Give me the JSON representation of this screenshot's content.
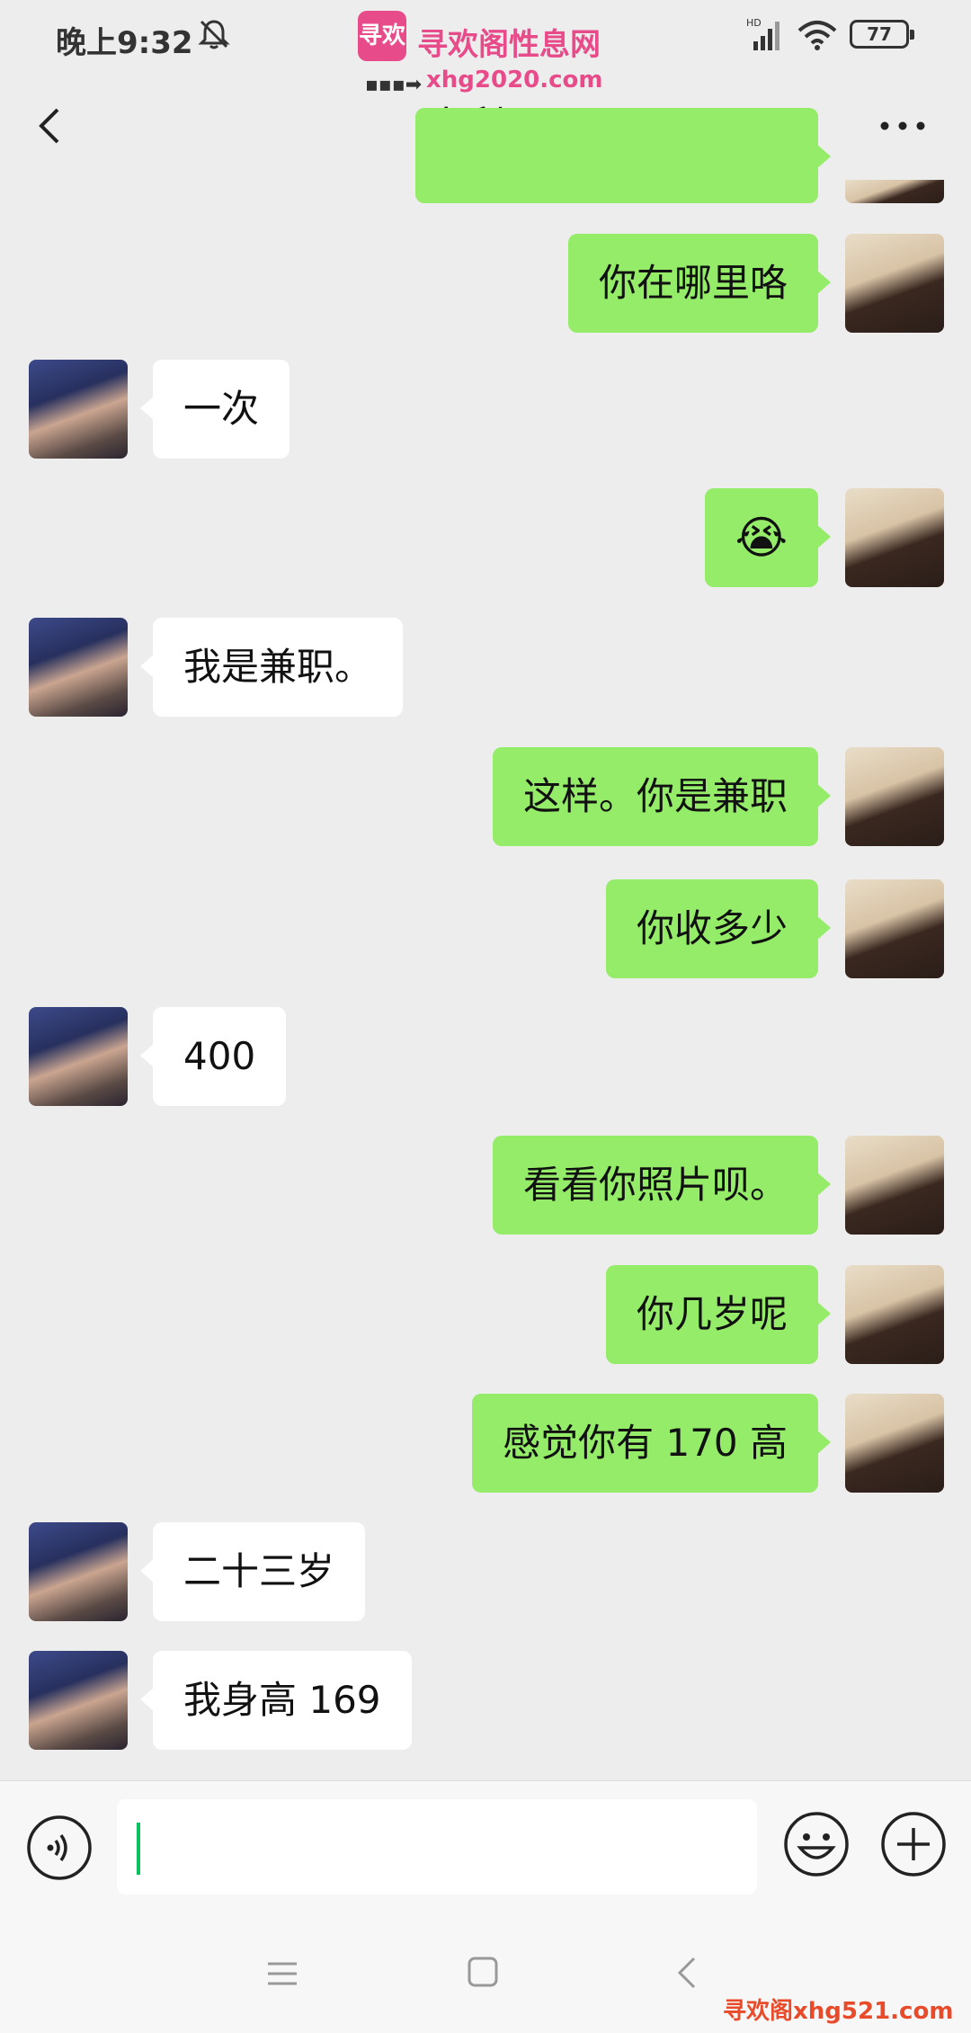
{
  "status_bar": {
    "time": "晚上9:32",
    "battery": "77",
    "signal_label": "HD"
  },
  "watermark": {
    "logo": "寻欢",
    "title": "寻欢阁性息网",
    "url": "xhg2020.com",
    "bottom": "寻欢阁xhg521.com"
  },
  "header": {
    "title": "小利子"
  },
  "messages": [
    {
      "from": "me",
      "text": "你在哪里咯"
    },
    {
      "from": "her",
      "text": "一次"
    },
    {
      "from": "me",
      "text": "😭"
    },
    {
      "from": "her",
      "text": "我是兼职。"
    },
    {
      "from": "me",
      "text": "这样。你是兼职"
    },
    {
      "from": "me",
      "text": "你收多少"
    },
    {
      "from": "her",
      "text": "400"
    },
    {
      "from": "me",
      "text": "看看你照片呗。"
    },
    {
      "from": "me",
      "text": "你几岁呢"
    },
    {
      "from": "me",
      "text": "感觉你有 170 高"
    },
    {
      "from": "her",
      "text": "二十三岁"
    },
    {
      "from": "her",
      "text": "我身高 169"
    }
  ],
  "input": {
    "value": ""
  },
  "colors": {
    "my_bubble": "#95ec69",
    "her_bubble": "#ffffff",
    "background": "#ededed",
    "caret": "#07c160",
    "watermark": "#e84b8a"
  },
  "icons": [
    "back-icon",
    "more-icon",
    "voice-icon",
    "emoji-icon",
    "add-icon",
    "nav-menu-icon",
    "nav-home-icon",
    "nav-back-icon"
  ]
}
